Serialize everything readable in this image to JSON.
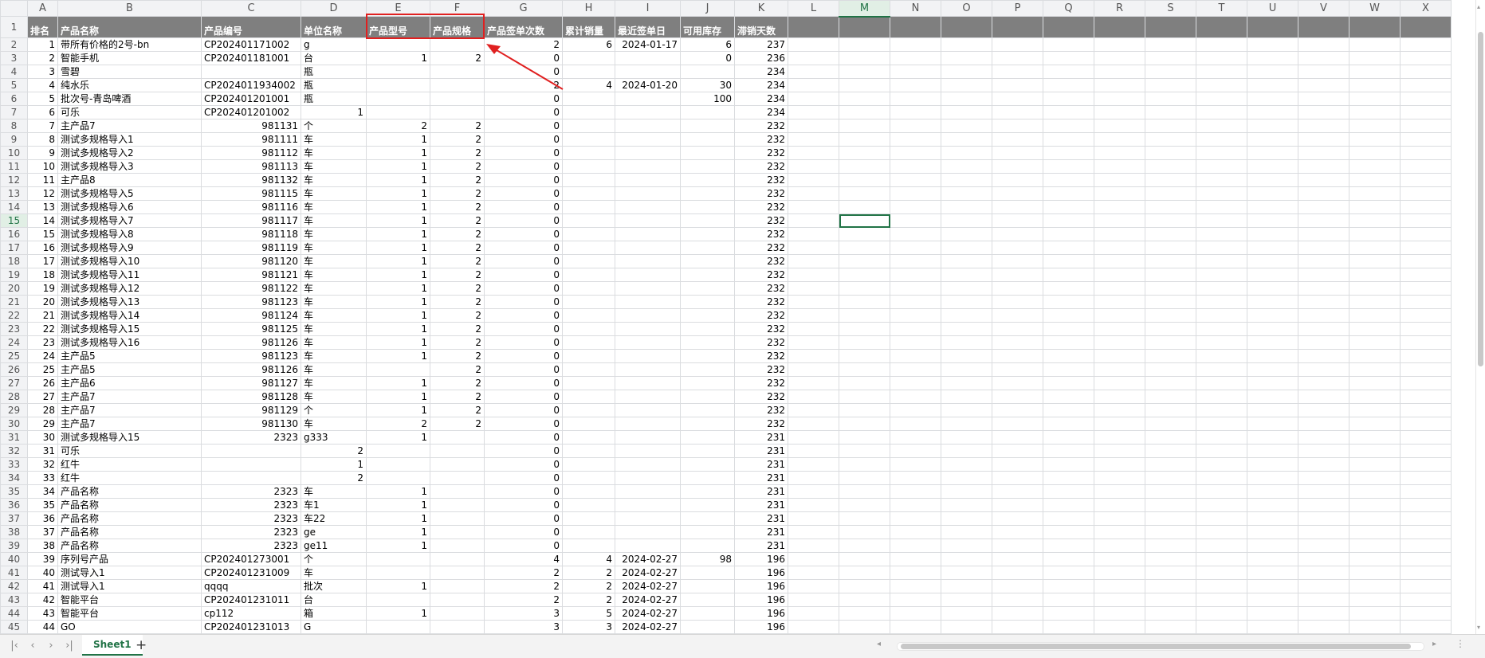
{
  "columns": [
    "A",
    "B",
    "C",
    "D",
    "E",
    "F",
    "G",
    "H",
    "I",
    "J",
    "K",
    "L",
    "M",
    "N",
    "O",
    "P",
    "Q",
    "R",
    "S",
    "T",
    "U",
    "V",
    "W",
    "X"
  ],
  "selected_column": "M",
  "selected_row": 15,
  "header_row": [
    "排名",
    "产品名称",
    "产品编号",
    "单位名称",
    "产品型号",
    "产品规格",
    "产品签单次数",
    "累计销量",
    "最近签单日",
    "可用库存",
    "滞销天数"
  ],
  "rows": [
    [
      "1",
      "带所有价格的2号-bn",
      "CP202401171002",
      "g",
      "",
      "",
      "2",
      "6",
      "2024-01-17",
      "6",
      "237"
    ],
    [
      "2",
      "智能手机",
      "CP202401181001",
      "台",
      "1",
      "2",
      "0",
      "",
      "",
      "0",
      "236"
    ],
    [
      "3",
      "雪碧",
      "",
      "瓶",
      "",
      "",
      "0",
      "",
      "",
      "",
      "234"
    ],
    [
      "4",
      "纯水乐",
      "CP2024011934002",
      "瓶",
      "",
      "",
      "2",
      "4",
      "2024-01-20",
      "30",
      "234"
    ],
    [
      "5",
      "批次号-青岛啤酒",
      "CP202401201001",
      "瓶",
      "",
      "",
      "0",
      "",
      "",
      "100",
      "234"
    ],
    [
      "6",
      "可乐",
      "CP202401201002",
      "1",
      "",
      "",
      "0",
      "",
      "",
      "",
      "234"
    ],
    [
      "7",
      "主产品7",
      "981131",
      "个",
      "2",
      "2",
      "0",
      "",
      "",
      "",
      "232"
    ],
    [
      "8",
      "测试多规格导入1",
      "981111",
      "车",
      "1",
      "2",
      "0",
      "",
      "",
      "",
      "232"
    ],
    [
      "9",
      "测试多规格导入2",
      "981112",
      "车",
      "1",
      "2",
      "0",
      "",
      "",
      "",
      "232"
    ],
    [
      "10",
      "测试多规格导入3",
      "981113",
      "车",
      "1",
      "2",
      "0",
      "",
      "",
      "",
      "232"
    ],
    [
      "11",
      "主产品8",
      "981132",
      "车",
      "1",
      "2",
      "0",
      "",
      "",
      "",
      "232"
    ],
    [
      "12",
      "测试多规格导入5",
      "981115",
      "车",
      "1",
      "2",
      "0",
      "",
      "",
      "",
      "232"
    ],
    [
      "13",
      "测试多规格导入6",
      "981116",
      "车",
      "1",
      "2",
      "0",
      "",
      "",
      "",
      "232"
    ],
    [
      "14",
      "测试多规格导入7",
      "981117",
      "车",
      "1",
      "2",
      "0",
      "",
      "",
      "",
      "232"
    ],
    [
      "15",
      "测试多规格导入8",
      "981118",
      "车",
      "1",
      "2",
      "0",
      "",
      "",
      "",
      "232"
    ],
    [
      "16",
      "测试多规格导入9",
      "981119",
      "车",
      "1",
      "2",
      "0",
      "",
      "",
      "",
      "232"
    ],
    [
      "17",
      "测试多规格导入10",
      "981120",
      "车",
      "1",
      "2",
      "0",
      "",
      "",
      "",
      "232"
    ],
    [
      "18",
      "测试多规格导入11",
      "981121",
      "车",
      "1",
      "2",
      "0",
      "",
      "",
      "",
      "232"
    ],
    [
      "19",
      "测试多规格导入12",
      "981122",
      "车",
      "1",
      "2",
      "0",
      "",
      "",
      "",
      "232"
    ],
    [
      "20",
      "测试多规格导入13",
      "981123",
      "车",
      "1",
      "2",
      "0",
      "",
      "",
      "",
      "232"
    ],
    [
      "21",
      "测试多规格导入14",
      "981124",
      "车",
      "1",
      "2",
      "0",
      "",
      "",
      "",
      "232"
    ],
    [
      "22",
      "测试多规格导入15",
      "981125",
      "车",
      "1",
      "2",
      "0",
      "",
      "",
      "",
      "232"
    ],
    [
      "23",
      "测试多规格导入16",
      "981126",
      "车",
      "1",
      "2",
      "0",
      "",
      "",
      "",
      "232"
    ],
    [
      "24",
      "主产品5",
      "981123",
      "车",
      "1",
      "2",
      "0",
      "",
      "",
      "",
      "232"
    ],
    [
      "25",
      "主产品5",
      "981126",
      "车",
      "",
      "2",
      "0",
      "",
      "",
      "",
      "232"
    ],
    [
      "26",
      "主产品6",
      "981127",
      "车",
      "1",
      "2",
      "0",
      "",
      "",
      "",
      "232"
    ],
    [
      "27",
      "主产品7",
      "981128",
      "车",
      "1",
      "2",
      "0",
      "",
      "",
      "",
      "232"
    ],
    [
      "28",
      "主产品7",
      "981129",
      "个",
      "1",
      "2",
      "0",
      "",
      "",
      "",
      "232"
    ],
    [
      "29",
      "主产品7",
      "981130",
      "车",
      "2",
      "2",
      "0",
      "",
      "",
      "",
      "232"
    ],
    [
      "30",
      "测试多规格导入15",
      "2323",
      "g333",
      "1",
      "",
      "0",
      "",
      "",
      "",
      "231"
    ],
    [
      "31",
      "可乐",
      "",
      "2",
      "",
      "",
      "0",
      "",
      "",
      "",
      "231"
    ],
    [
      "32",
      "红牛",
      "",
      "1",
      "",
      "",
      "0",
      "",
      "",
      "",
      "231"
    ],
    [
      "33",
      "红牛",
      "",
      "2",
      "",
      "",
      "0",
      "",
      "",
      "",
      "231"
    ],
    [
      "34",
      "产品名称",
      "2323",
      "车",
      "1",
      "",
      "0",
      "",
      "",
      "",
      "231"
    ],
    [
      "35",
      "产品名称",
      "2323",
      "车1",
      "1",
      "",
      "0",
      "",
      "",
      "",
      "231"
    ],
    [
      "36",
      "产品名称",
      "2323",
      "车22",
      "1",
      "",
      "0",
      "",
      "",
      "",
      "231"
    ],
    [
      "37",
      "产品名称",
      "2323",
      "ge",
      "1",
      "",
      "0",
      "",
      "",
      "",
      "231"
    ],
    [
      "38",
      "产品名称",
      "2323",
      "ge11",
      "1",
      "",
      "0",
      "",
      "",
      "",
      "231"
    ],
    [
      "39",
      "序列号产品",
      "CP202401273001",
      "个",
      "",
      "",
      "4",
      "4",
      "2024-02-27",
      "98",
      "196"
    ],
    [
      "40",
      "测试导入1",
      "CP202401231009",
      "车",
      "",
      "",
      "2",
      "2",
      "2024-02-27",
      "",
      "196"
    ],
    [
      "41",
      "测试导入1",
      "qqqq",
      "批次",
      "1",
      "",
      "2",
      "2",
      "2024-02-27",
      "",
      "196"
    ],
    [
      "42",
      "智能平台",
      "CP202401231011",
      "台",
      "",
      "",
      "2",
      "2",
      "2024-02-27",
      "",
      "196"
    ],
    [
      "43",
      "智能平台",
      "cp112",
      "箱",
      "1",
      "",
      "3",
      "5",
      "2024-02-27",
      "",
      "196"
    ],
    [
      "44",
      "GO",
      "CP202401231013",
      "G",
      "",
      "",
      "3",
      "3",
      "2024-02-27",
      "",
      "196"
    ]
  ],
  "sheet_tab": "Sheet1",
  "add_sheet_icon": "+",
  "nav": {
    "first": "|‹",
    "prev": "‹",
    "next": "›",
    "last": "›|"
  },
  "scroll": {
    "left": "◂",
    "right": "▸",
    "up": "▴",
    "down": "▾",
    "more": "⋮"
  }
}
